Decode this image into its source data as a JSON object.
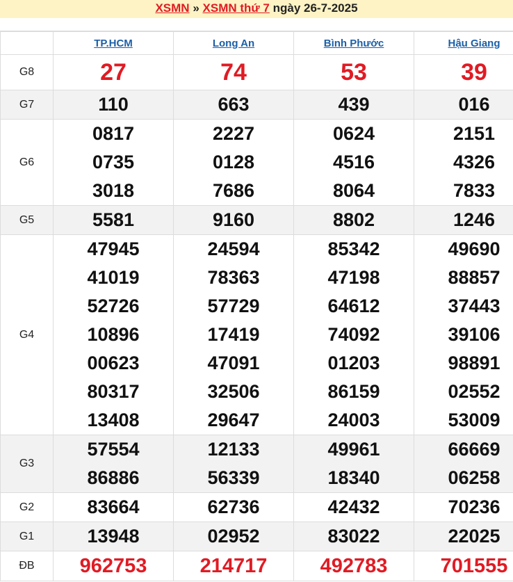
{
  "header": {
    "link1": "XSMN",
    "separator": "»",
    "link2": "XSMN thứ 7",
    "date_text": "ngày 26-7-2025"
  },
  "provinces": [
    "TP.HCM",
    "Long An",
    "Bình Phước",
    "Hậu Giang"
  ],
  "rows": [
    {
      "label": "G8",
      "style": "g8",
      "values": [
        [
          "27"
        ],
        [
          "74"
        ],
        [
          "53"
        ],
        [
          "39"
        ]
      ]
    },
    {
      "label": "G7",
      "style": "alt",
      "values": [
        [
          "110"
        ],
        [
          "663"
        ],
        [
          "439"
        ],
        [
          "016"
        ]
      ]
    },
    {
      "label": "G6",
      "style": "",
      "values": [
        [
          "0817",
          "0735",
          "3018"
        ],
        [
          "2227",
          "0128",
          "7686"
        ],
        [
          "0624",
          "4516",
          "8064"
        ],
        [
          "2151",
          "4326",
          "7833"
        ]
      ]
    },
    {
      "label": "G5",
      "style": "alt",
      "values": [
        [
          "5581"
        ],
        [
          "9160"
        ],
        [
          "8802"
        ],
        [
          "1246"
        ]
      ]
    },
    {
      "label": "G4",
      "style": "",
      "values": [
        [
          "47945",
          "41019",
          "52726",
          "10896",
          "00623",
          "80317",
          "13408"
        ],
        [
          "24594",
          "78363",
          "57729",
          "17419",
          "47091",
          "32506",
          "29647"
        ],
        [
          "85342",
          "47198",
          "64612",
          "74092",
          "01203",
          "86159",
          "24003"
        ],
        [
          "49690",
          "88857",
          "37443",
          "39106",
          "98891",
          "02552",
          "53009"
        ]
      ]
    },
    {
      "label": "G3",
      "style": "alt",
      "values": [
        [
          "57554",
          "86886"
        ],
        [
          "12133",
          "56339"
        ],
        [
          "49961",
          "18340"
        ],
        [
          "66669",
          "06258"
        ]
      ]
    },
    {
      "label": "G2",
      "style": "",
      "values": [
        [
          "83664"
        ],
        [
          "62736"
        ],
        [
          "42432"
        ],
        [
          "70236"
        ]
      ]
    },
    {
      "label": "G1",
      "style": "alt",
      "values": [
        [
          "13948"
        ],
        [
          "02952"
        ],
        [
          "83022"
        ],
        [
          "22025"
        ]
      ]
    },
    {
      "label": "ĐB",
      "style": "db",
      "values": [
        [
          "962753"
        ],
        [
          "214717"
        ],
        [
          "492783"
        ],
        [
          "701555"
        ]
      ]
    }
  ],
  "colors": {
    "accent_red": "#e01b24",
    "link_blue": "#1b5fa8",
    "header_bg": "#fdf3c4"
  }
}
